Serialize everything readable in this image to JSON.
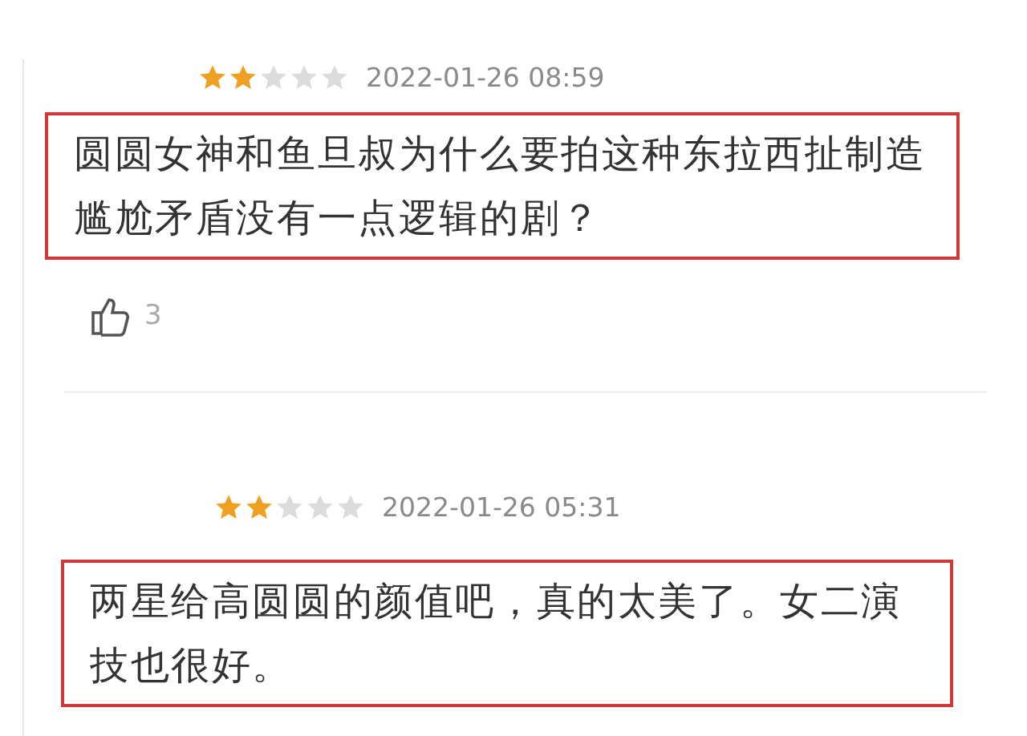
{
  "comments": [
    {
      "stars": 2,
      "time": "2022-01-26 08:59",
      "text": "圆圆女神和鱼旦叔为什么要拍这种东拉西扯制造尴尬矛盾没有一点逻辑的剧？",
      "likes": "3"
    },
    {
      "stars": 2,
      "time": "2022-01-26 05:31",
      "text": "两星给高圆圆的颜值吧，真的太美了。女二演技也很好。"
    }
  ]
}
